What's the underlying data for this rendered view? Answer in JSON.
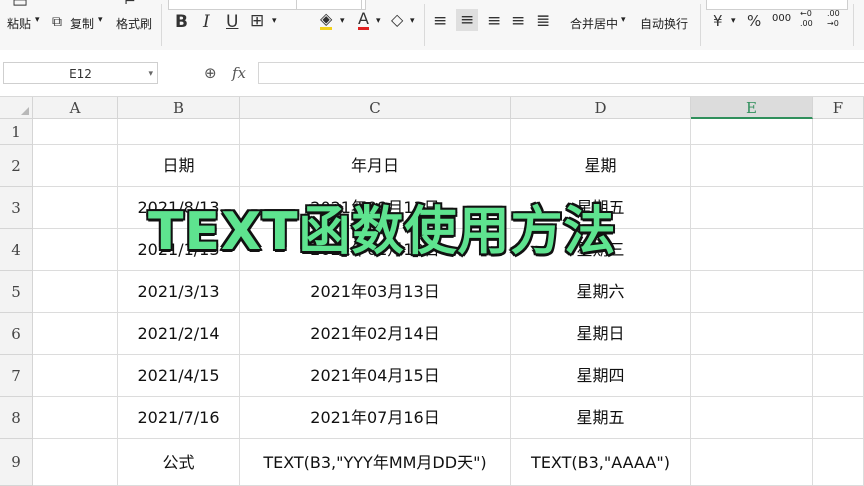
{
  "ribbon": {
    "paste_label": "粘贴",
    "copy_label": "复制",
    "format_painter_label": "格式刷",
    "merge_center_label": "合并居中",
    "wrap_text_label": "自动换行",
    "bold_label": "B",
    "italic_label": "I",
    "underline_label": "U",
    "currency_symbol": "¥",
    "percent_symbol": "%",
    "thousands_symbol": "000",
    "inc_decimal_symbol": "←0 .00",
    "dec_decimal_symbol": ".00 →0"
  },
  "formula_bar": {
    "name_box": "E12",
    "fx_label": "fx",
    "value": ""
  },
  "columns": [
    "A",
    "B",
    "C",
    "D",
    "E",
    "F"
  ],
  "selected_column": "E",
  "rows": [
    "1",
    "2",
    "3",
    "4",
    "5",
    "6",
    "7",
    "8",
    "9"
  ],
  "cells": {
    "B2": "日期",
    "C2": "年月日",
    "D2": "星期",
    "B3": "2021/8/13",
    "C3": "2021年08月13日",
    "D3": "星期五",
    "B4": "2021/1/13",
    "C4": "2021年01月13日",
    "D4": "星期三",
    "B5": "2021/3/13",
    "C5": "2021年03月13日",
    "D5": "星期六",
    "B6": "2021/2/14",
    "C6": "2021年02月14日",
    "D6": "星期日",
    "B7": "2021/4/15",
    "C7": "2021年04月15日",
    "D7": "星期四",
    "B8": "2021/7/16",
    "C8": "2021年07月16日",
    "D8": "星期五",
    "B9": "公式",
    "C9": "TEXT(B3,\"YYY年MM月DD天\")",
    "D9": "TEXT(B3,\"AAAA\")"
  },
  "overlay_title": "TEXT函数使用方法",
  "colors": {
    "accent_green": "#2f8f5b",
    "overlay_fill": "#5ee38f",
    "overlay_stroke": "#111111"
  }
}
